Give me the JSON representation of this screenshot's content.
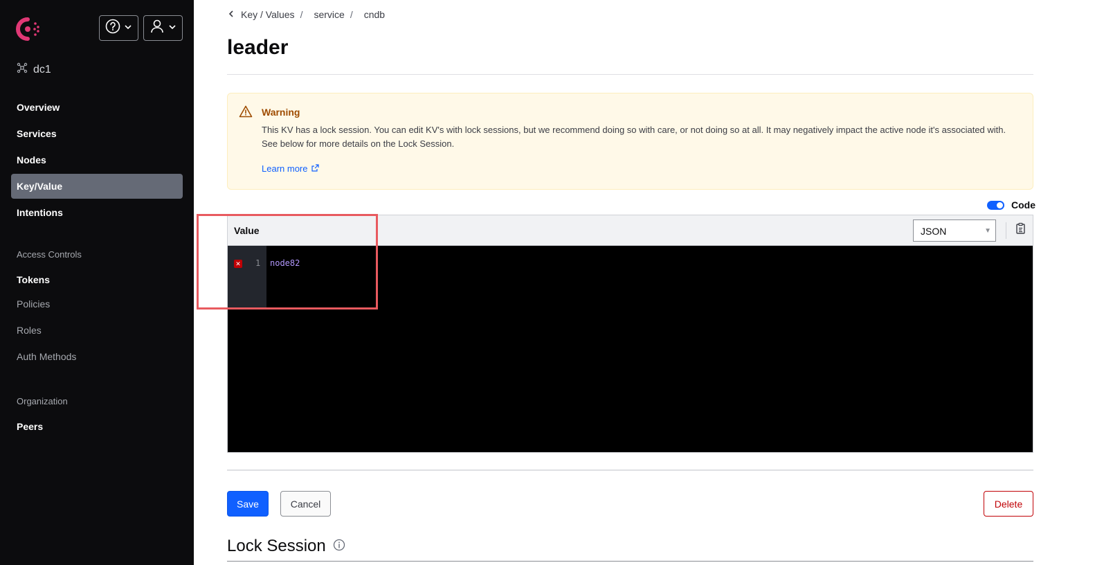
{
  "sidebar": {
    "datacenter": "dc1",
    "nav_primary": [
      {
        "label": "Overview"
      },
      {
        "label": "Services"
      },
      {
        "label": "Nodes"
      },
      {
        "label": "Key/Value"
      },
      {
        "label": "Intentions"
      }
    ],
    "access_controls": {
      "heading": "Access Controls",
      "items": [
        {
          "label": "Tokens"
        },
        {
          "label": "Policies"
        },
        {
          "label": "Roles"
        },
        {
          "label": "Auth Methods"
        }
      ]
    },
    "organization": {
      "heading": "Organization",
      "items": [
        {
          "label": "Peers"
        }
      ]
    }
  },
  "breadcrumb": {
    "items": [
      "Key / Values",
      "service",
      "cndb"
    ]
  },
  "page": {
    "title": "leader"
  },
  "warning": {
    "title": "Warning",
    "text": "This KV has a lock session. You can edit KV's with lock sessions, but we recommend doing so with care, or not doing so at all. It may negatively impact the active node it's associated with. See below for more details on the Lock Session.",
    "link": "Learn more"
  },
  "editor": {
    "code_toggle_label": "Code",
    "code_toggle_on": true,
    "label": "Value",
    "syntax": "JSON",
    "line_number": "1",
    "code": "node82"
  },
  "actions": {
    "save": "Save",
    "cancel": "Cancel",
    "delete": "Delete"
  },
  "lock_section": {
    "title": "Lock Session"
  },
  "colors": {
    "sidebar_bg": "#0c0c0e",
    "active_nav": "#656a76",
    "primary": "#1060ff",
    "danger": "#c00005",
    "warning_bg": "#fff9e8",
    "brand": "#e03875"
  }
}
